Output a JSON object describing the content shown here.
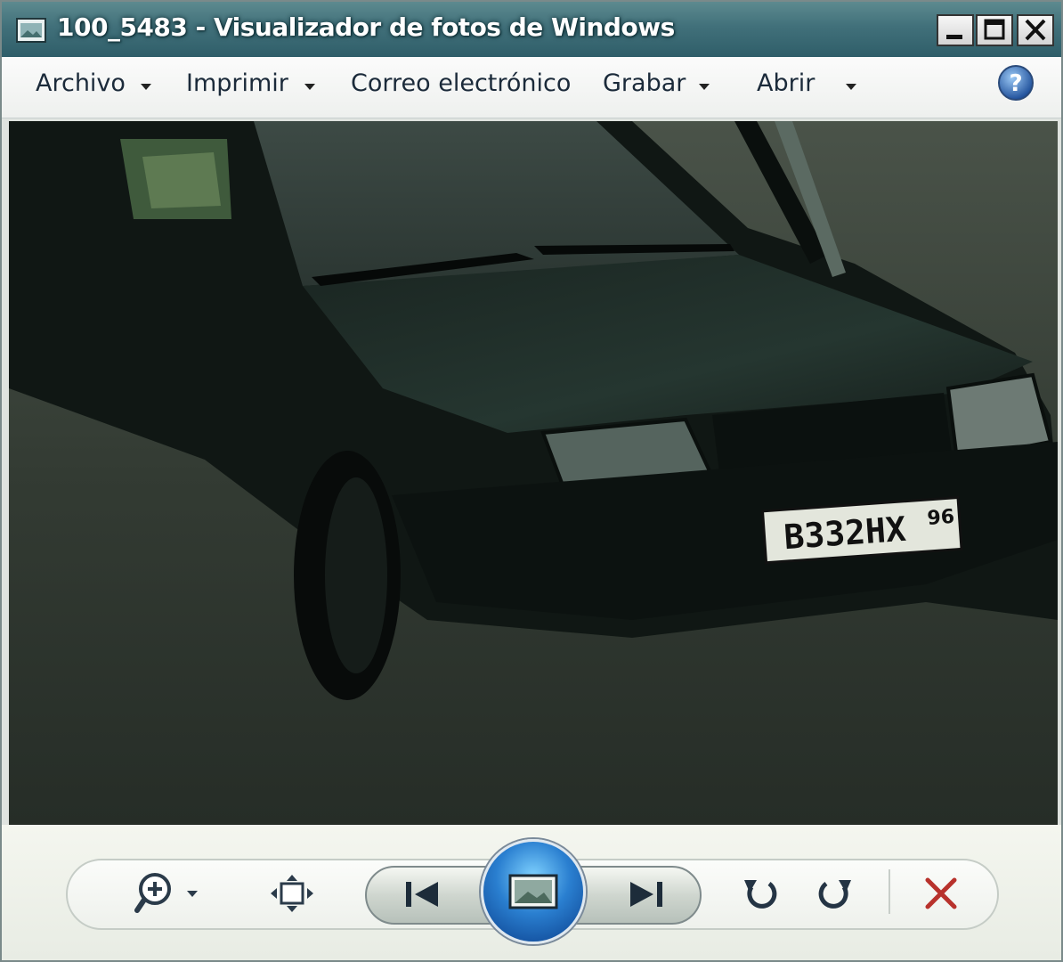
{
  "window": {
    "title": "100_5483 - Visualizador de fotos de Windows"
  },
  "menu": {
    "items": [
      {
        "label": "Archivo",
        "has_dropdown": true
      },
      {
        "label": "Imprimir",
        "has_dropdown": true
      },
      {
        "label": "Correo electrónico",
        "has_dropdown": false
      },
      {
        "label": "Grabar",
        "has_dropdown": true
      },
      {
        "label": "Abrir",
        "has_dropdown": true
      }
    ],
    "help_icon": "help-icon"
  },
  "photo": {
    "plate_text": "B332HX",
    "plate_region": "96"
  },
  "controls": {
    "zoom_icon": "zoom-icon",
    "fit_icon": "actual-size-icon",
    "prev_icon": "previous-icon",
    "slideshow_icon": "slideshow-icon",
    "next_icon": "next-icon",
    "rotate_left_icon": "rotate-ccw-icon",
    "rotate_right_icon": "rotate-cw-icon",
    "delete_icon": "delete-icon"
  },
  "colors": {
    "delete": "#b8322c",
    "accent": "#2a7fd0"
  }
}
